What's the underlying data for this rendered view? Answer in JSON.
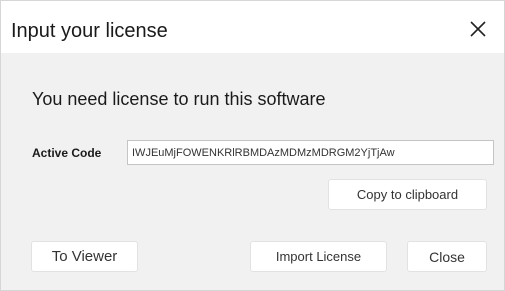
{
  "dialog": {
    "title": "Input your license",
    "close_icon": "close-icon",
    "message": "You need license to run this software",
    "active_code_label": "Active Code",
    "active_code_value": "IWJEuMjFOWENKRlRBMDAzMDMzMDRGM2YjTjAw",
    "copy_button_label": "Copy to clipboard",
    "to_viewer_button_label": "To Viewer",
    "import_license_button_label": "Import License",
    "close_button_label": "Close"
  },
  "colors": {
    "dialog_background": "#f1f1f1",
    "titlebar_background": "#ffffff",
    "button_background": "#ffffff",
    "text": "#1a1a1a"
  }
}
